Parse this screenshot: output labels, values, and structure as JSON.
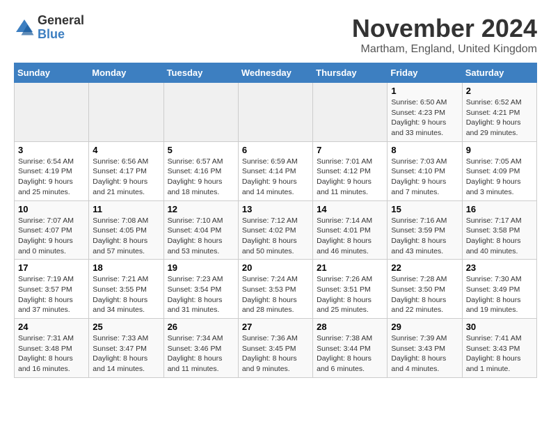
{
  "logo": {
    "general": "General",
    "blue": "Blue"
  },
  "title": "November 2024",
  "subtitle": "Martham, England, United Kingdom",
  "days_of_week": [
    "Sunday",
    "Monday",
    "Tuesday",
    "Wednesday",
    "Thursday",
    "Friday",
    "Saturday"
  ],
  "weeks": [
    [
      {
        "day": "",
        "info": ""
      },
      {
        "day": "",
        "info": ""
      },
      {
        "day": "",
        "info": ""
      },
      {
        "day": "",
        "info": ""
      },
      {
        "day": "",
        "info": ""
      },
      {
        "day": "1",
        "info": "Sunrise: 6:50 AM\nSunset: 4:23 PM\nDaylight: 9 hours\nand 33 minutes."
      },
      {
        "day": "2",
        "info": "Sunrise: 6:52 AM\nSunset: 4:21 PM\nDaylight: 9 hours\nand 29 minutes."
      }
    ],
    [
      {
        "day": "3",
        "info": "Sunrise: 6:54 AM\nSunset: 4:19 PM\nDaylight: 9 hours\nand 25 minutes."
      },
      {
        "day": "4",
        "info": "Sunrise: 6:56 AM\nSunset: 4:17 PM\nDaylight: 9 hours\nand 21 minutes."
      },
      {
        "day": "5",
        "info": "Sunrise: 6:57 AM\nSunset: 4:16 PM\nDaylight: 9 hours\nand 18 minutes."
      },
      {
        "day": "6",
        "info": "Sunrise: 6:59 AM\nSunset: 4:14 PM\nDaylight: 9 hours\nand 14 minutes."
      },
      {
        "day": "7",
        "info": "Sunrise: 7:01 AM\nSunset: 4:12 PM\nDaylight: 9 hours\nand 11 minutes."
      },
      {
        "day": "8",
        "info": "Sunrise: 7:03 AM\nSunset: 4:10 PM\nDaylight: 9 hours\nand 7 minutes."
      },
      {
        "day": "9",
        "info": "Sunrise: 7:05 AM\nSunset: 4:09 PM\nDaylight: 9 hours\nand 3 minutes."
      }
    ],
    [
      {
        "day": "10",
        "info": "Sunrise: 7:07 AM\nSunset: 4:07 PM\nDaylight: 9 hours\nand 0 minutes."
      },
      {
        "day": "11",
        "info": "Sunrise: 7:08 AM\nSunset: 4:05 PM\nDaylight: 8 hours\nand 57 minutes."
      },
      {
        "day": "12",
        "info": "Sunrise: 7:10 AM\nSunset: 4:04 PM\nDaylight: 8 hours\nand 53 minutes."
      },
      {
        "day": "13",
        "info": "Sunrise: 7:12 AM\nSunset: 4:02 PM\nDaylight: 8 hours\nand 50 minutes."
      },
      {
        "day": "14",
        "info": "Sunrise: 7:14 AM\nSunset: 4:01 PM\nDaylight: 8 hours\nand 46 minutes."
      },
      {
        "day": "15",
        "info": "Sunrise: 7:16 AM\nSunset: 3:59 PM\nDaylight: 8 hours\nand 43 minutes."
      },
      {
        "day": "16",
        "info": "Sunrise: 7:17 AM\nSunset: 3:58 PM\nDaylight: 8 hours\nand 40 minutes."
      }
    ],
    [
      {
        "day": "17",
        "info": "Sunrise: 7:19 AM\nSunset: 3:57 PM\nDaylight: 8 hours\nand 37 minutes."
      },
      {
        "day": "18",
        "info": "Sunrise: 7:21 AM\nSunset: 3:55 PM\nDaylight: 8 hours\nand 34 minutes."
      },
      {
        "day": "19",
        "info": "Sunrise: 7:23 AM\nSunset: 3:54 PM\nDaylight: 8 hours\nand 31 minutes."
      },
      {
        "day": "20",
        "info": "Sunrise: 7:24 AM\nSunset: 3:53 PM\nDaylight: 8 hours\nand 28 minutes."
      },
      {
        "day": "21",
        "info": "Sunrise: 7:26 AM\nSunset: 3:51 PM\nDaylight: 8 hours\nand 25 minutes."
      },
      {
        "day": "22",
        "info": "Sunrise: 7:28 AM\nSunset: 3:50 PM\nDaylight: 8 hours\nand 22 minutes."
      },
      {
        "day": "23",
        "info": "Sunrise: 7:30 AM\nSunset: 3:49 PM\nDaylight: 8 hours\nand 19 minutes."
      }
    ],
    [
      {
        "day": "24",
        "info": "Sunrise: 7:31 AM\nSunset: 3:48 PM\nDaylight: 8 hours\nand 16 minutes."
      },
      {
        "day": "25",
        "info": "Sunrise: 7:33 AM\nSunset: 3:47 PM\nDaylight: 8 hours\nand 14 minutes."
      },
      {
        "day": "26",
        "info": "Sunrise: 7:34 AM\nSunset: 3:46 PM\nDaylight: 8 hours\nand 11 minutes."
      },
      {
        "day": "27",
        "info": "Sunrise: 7:36 AM\nSunset: 3:45 PM\nDaylight: 8 hours\nand 9 minutes."
      },
      {
        "day": "28",
        "info": "Sunrise: 7:38 AM\nSunset: 3:44 PM\nDaylight: 8 hours\nand 6 minutes."
      },
      {
        "day": "29",
        "info": "Sunrise: 7:39 AM\nSunset: 3:43 PM\nDaylight: 8 hours\nand 4 minutes."
      },
      {
        "day": "30",
        "info": "Sunrise: 7:41 AM\nSunset: 3:43 PM\nDaylight: 8 hours\nand 1 minute."
      }
    ]
  ]
}
